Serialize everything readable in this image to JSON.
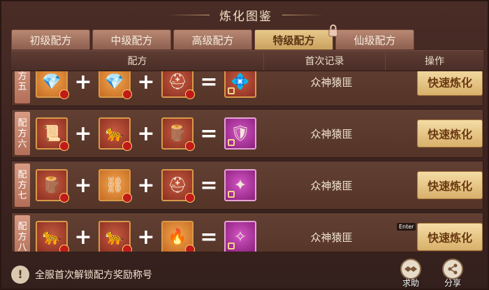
{
  "title": "炼化图鉴",
  "tabs": [
    {
      "label": "初级配方"
    },
    {
      "label": "中级配方"
    },
    {
      "label": "高级配方"
    },
    {
      "label": "特级配方"
    },
    {
      "label": "仙级配方"
    }
  ],
  "columns": {
    "recipe": "配方",
    "first_record": "首次记录",
    "action": "操作"
  },
  "rows": [
    {
      "label": "方五",
      "items": [
        "purple-crystal",
        "purple-crystal",
        "iron-helmet",
        "blue-crystal"
      ],
      "record": "众神猿匪",
      "button": "快速炼化"
    },
    {
      "label": "配方六",
      "items": [
        "cloth-scroll",
        "leopard-fur",
        "wooden-table",
        "green-armor"
      ],
      "record": "众神猿匪",
      "button": "快速炼化"
    },
    {
      "label": "配方七",
      "items": [
        "wood-plank",
        "iron-ore",
        "iron-helmet",
        "golden-staff"
      ],
      "record": "众神猿匪",
      "button": "快速炼化"
    },
    {
      "label": "配方八",
      "items": [
        "leopard-fur",
        "leopard-fur",
        "fire-orb",
        "pink-feather"
      ],
      "record": "众神猿匪",
      "button": "快速炼化"
    }
  ],
  "footer": {
    "hint": "全服首次解锁配方奖励称号",
    "help_label": "求助",
    "share_label": "分享"
  },
  "tooltip": "Enter",
  "colors": {
    "active_tab": "#e8c98b",
    "button": "#f4dca4",
    "row_bg": "#623f33"
  }
}
